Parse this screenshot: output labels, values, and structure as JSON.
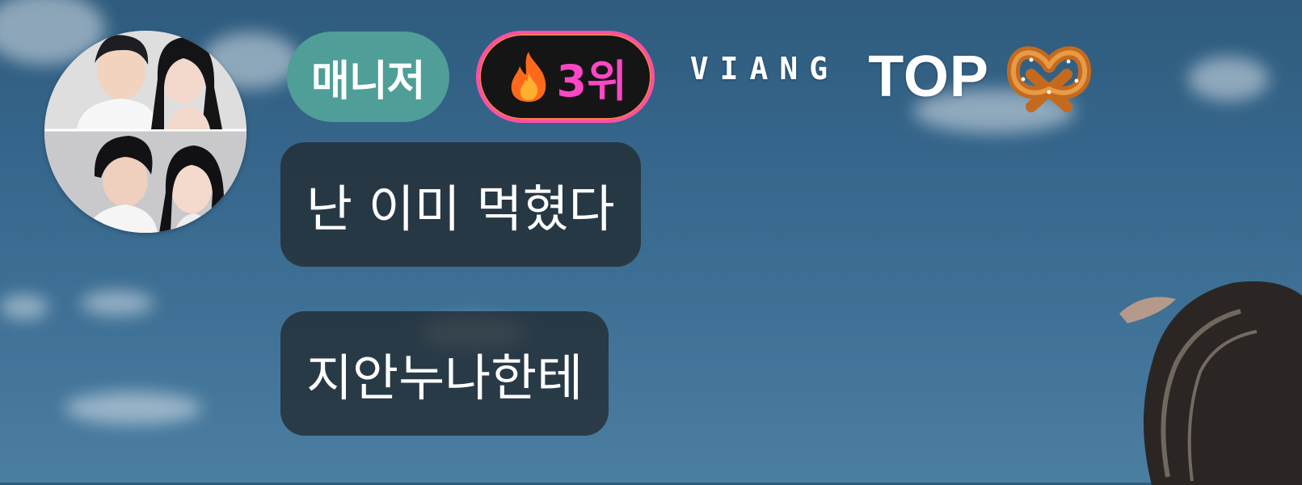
{
  "header": {
    "role_badge": "매니저",
    "rank_badge": "3위",
    "rank_icon": "fire-icon",
    "viang_label": "VIANG",
    "top_label": "TOP",
    "top_icon": "pretzel-icon"
  },
  "messages": [
    {
      "text": "난 이미 먹혔다"
    },
    {
      "text": "지안누나한테"
    }
  ],
  "colors": {
    "role_badge_bg": "#4f9e98",
    "rank_badge_text": "#ff47c6",
    "rank_badge_border": "#ff4fa5",
    "bubble_bg": "#232d34"
  }
}
